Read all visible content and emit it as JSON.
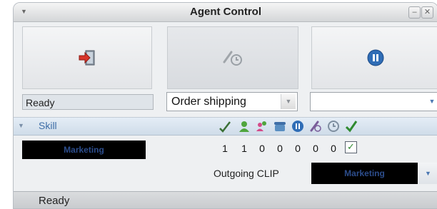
{
  "window": {
    "title": "Agent Control",
    "menu_icon": "chevron-down-icon",
    "minimize_icon": "minimize-icon",
    "close_icon": "close-icon"
  },
  "buttons": [
    {
      "name": "login-button",
      "icon": "login-door-icon"
    },
    {
      "name": "schedule-button",
      "icon": "phone-clock-icon"
    },
    {
      "name": "pause-button",
      "icon": "pause-icon"
    }
  ],
  "status_field": "Ready",
  "activity_combo": {
    "value": "Order shipping"
  },
  "second_combo": {
    "value": ""
  },
  "grid": {
    "header": {
      "label": "Skill"
    },
    "column_icons": [
      "check-pen-icon",
      "agent-icon",
      "users-transfer-icon",
      "phone-icon",
      "pause-icon",
      "phone-hand-icon",
      "clock-icon",
      "green-check-icon"
    ],
    "rows": [
      {
        "skill": "Marketing",
        "values": [
          "1",
          "1",
          "0",
          "0",
          "0",
          "0",
          "0"
        ],
        "enabled": true
      }
    ]
  },
  "outgoing_clip": {
    "label": "Outgoing CLIP",
    "value": "Marketing"
  },
  "statusbar": {
    "text": "Ready"
  },
  "colors": {
    "accent_blue": "#2f6db6",
    "header_blue": "#3e6ea7",
    "login_red": "#d8342a",
    "check_green": "#2f8a2f"
  }
}
